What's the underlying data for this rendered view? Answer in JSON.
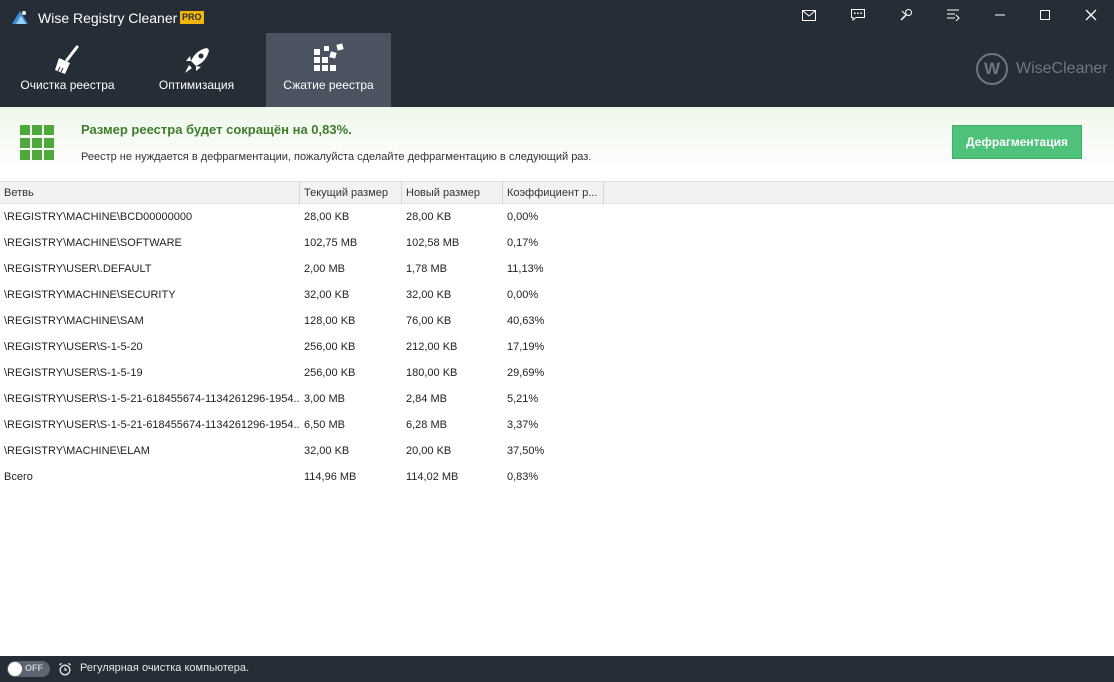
{
  "window": {
    "title": "Wise Registry Cleaner X",
    "badge": "PRO"
  },
  "tabs": [
    {
      "label": "Очистка реестра",
      "icon": "broom-icon"
    },
    {
      "label": "Оптимизация",
      "icon": "rocket-icon"
    },
    {
      "label": "Сжатие реестра",
      "icon": "compress-blocks-icon"
    }
  ],
  "brand": {
    "letter": "W",
    "name": "WiseCleaner"
  },
  "banner": {
    "title": "Размер реестра будет сокращён на 0,83%.",
    "subtitle": "Реестр не нуждается в дефрагментации, пожалуйста сделайте дефрагментацию в следующий раз.",
    "button": "Дефрагментация"
  },
  "table": {
    "columns": [
      "Ветвь",
      "Текущий размер",
      "Новый размер",
      "Коэффициент р..."
    ],
    "rows": [
      [
        "\\REGISTRY\\MACHINE\\BCD00000000",
        "28,00 KB",
        "28,00 KB",
        "0,00%"
      ],
      [
        "\\REGISTRY\\MACHINE\\SOFTWARE",
        "102,75 MB",
        "102,58 MB",
        "0,17%"
      ],
      [
        "\\REGISTRY\\USER\\.DEFAULT",
        "2,00 MB",
        "1,78 MB",
        "11,13%"
      ],
      [
        "\\REGISTRY\\MACHINE\\SECURITY",
        "32,00 KB",
        "32,00 KB",
        "0,00%"
      ],
      [
        "\\REGISTRY\\MACHINE\\SAM",
        "128,00 KB",
        "76,00 KB",
        "40,63%"
      ],
      [
        "\\REGISTRY\\USER\\S-1-5-20",
        "256,00 KB",
        "212,00 KB",
        "17,19%"
      ],
      [
        "\\REGISTRY\\USER\\S-1-5-19",
        "256,00 KB",
        "180,00 KB",
        "29,69%"
      ],
      [
        "\\REGISTRY\\USER\\S-1-5-21-618455674-1134261296-1954...",
        "3,00 MB",
        "2,84 MB",
        "5,21%"
      ],
      [
        "\\REGISTRY\\USER\\S-1-5-21-618455674-1134261296-1954...",
        "6,50 MB",
        "6,28 MB",
        "3,37%"
      ],
      [
        "\\REGISTRY\\MACHINE\\ELAM",
        "32,00 KB",
        "20,00 KB",
        "37,50%"
      ],
      [
        "Всего",
        "114,96 MB",
        "114,02 MB",
        "0,83%"
      ]
    ]
  },
  "footer": {
    "toggle": "OFF",
    "text": "Регулярная очистка компьютера."
  },
  "colors": {
    "header": "#252d37",
    "activeTab": "#4b5360",
    "accent": "#4ec17a",
    "bannerTitle": "#3e7d2c"
  }
}
